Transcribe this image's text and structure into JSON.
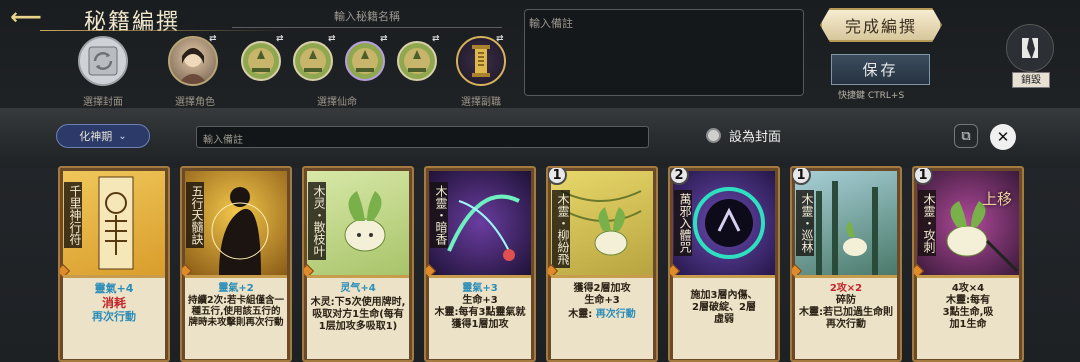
{
  "header": {
    "back_icon": "back-arrow-icon",
    "title": "秘籍編撰",
    "name_placeholder": "輸入秘籍名稱",
    "note_placeholder": "輸入備註"
  },
  "slots": {
    "cover_label": "選擇封面",
    "character_label": "選擇角色",
    "immortal_label": "選擇仙命",
    "deputy_label": "選擇副職",
    "swap_glyph": "⇄"
  },
  "actions": {
    "complete_label": "完成編撰",
    "save_label": "保存",
    "shortcut_label": "快捷鍵 CTRL+S",
    "destroy_label": "銷毀"
  },
  "toolbar": {
    "realm_label": "化神期",
    "note2_placeholder": "輸入備註",
    "cover_toggle_label": "設為封面"
  },
  "cards": [
    {
      "name": "千里神行符",
      "cost": "",
      "lines": [
        "靈氣+4",
        "消耗",
        "再次行動"
      ]
    },
    {
      "name": "五行天髓訣",
      "cost": "",
      "lines": [
        "靈氣+2",
        "持續2次:若卡組僅含一種五行,使用該五行的牌時未攻擊則再次行動"
      ]
    },
    {
      "name": "木灵・散枝叶",
      "cost": "",
      "lines": [
        "灵气+4",
        "木灵:下5次使用牌时,吸取对方1生命(每有1层加攻多吸取1)"
      ]
    },
    {
      "name": "木靈・暗香",
      "cost": "",
      "lines": [
        "靈氣+3",
        "生命+3",
        "木靈:每有3點靈氣就獲得1層加攻"
      ]
    },
    {
      "name": "木靈・柳紛飛",
      "cost": "1",
      "lines": [
        "獲得2層加攻",
        "生命+3",
        "木靈:",
        "再次行動"
      ]
    },
    {
      "name": "萬邪入體咒",
      "cost": "2",
      "lines": [
        "施加3層內傷、",
        "2層破綻、2層",
        "虛弱"
      ]
    },
    {
      "name": "木靈・巡林",
      "cost": "1",
      "lines": [
        "2攻×2",
        "碎防",
        "木靈:若已加過生命則再次行動"
      ]
    },
    {
      "name": "木靈・攻刺",
      "cost": "1",
      "lines": [
        "4攻×4",
        "木靈:每有",
        "3點生命,吸",
        "加1生命"
      ]
    }
  ],
  "move_up_label": "上移"
}
